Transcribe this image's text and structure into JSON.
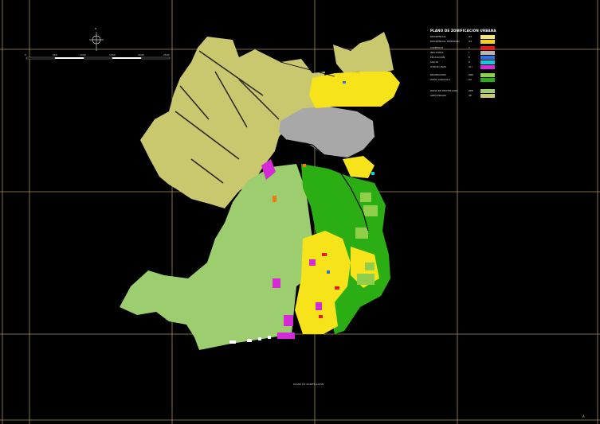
{
  "legend": {
    "title": "PLANO DE ZONIFICACION URBANA",
    "items": [
      {
        "label": "RESIDENCIAL",
        "code": "R3",
        "color": "#f4e37a"
      },
      {
        "label": "RESIDENCIAL DENSIDAD",
        "code": "R4",
        "color": "#f6d21e"
      },
      {
        "label": "COMERCIO",
        "code": "C",
        "color": "#e51b1b"
      },
      {
        "label": "INDUSTRIA",
        "code": "I",
        "color": "#b4b4b4"
      },
      {
        "label": "EDUCACION",
        "code": "E",
        "color": "#2f6fe0"
      },
      {
        "label": "SALUD",
        "code": "H",
        "color": "#19c7d8"
      },
      {
        "label": "OTROS USOS",
        "code": "OU",
        "color": "#d52bd6"
      },
      {
        "label": "RECREACION",
        "code": "ZRP",
        "color": "#8fcf4a"
      },
      {
        "label": "ZONA AGRICOLA",
        "code": "ZA",
        "color": "#2aae13"
      },
      {
        "label": "ZONA DE PROTECCION",
        "code": "ZPE",
        "color": "#9ccd6e"
      },
      {
        "label": "AREA ERIAZA",
        "code": "AE",
        "color": "#c9c86f"
      }
    ]
  },
  "scale_bar": {
    "labels": [
      "0",
      "500",
      "1000",
      "1500",
      "2000",
      "2500"
    ]
  },
  "north_arrow": {
    "label": "N"
  },
  "caption": "PLANO DE ZONIFICACION",
  "corner_label": "A",
  "colors": {
    "background": "#000000",
    "grid": "#a8905a",
    "desert": "#c9c86f",
    "protection": "#9ccd6e",
    "agricultural": "#2aae13",
    "residential": "#f6e31a",
    "industrial": "#a8a8a8",
    "other_uses": "#d52bd6",
    "recreation": "#8fcf4a"
  }
}
